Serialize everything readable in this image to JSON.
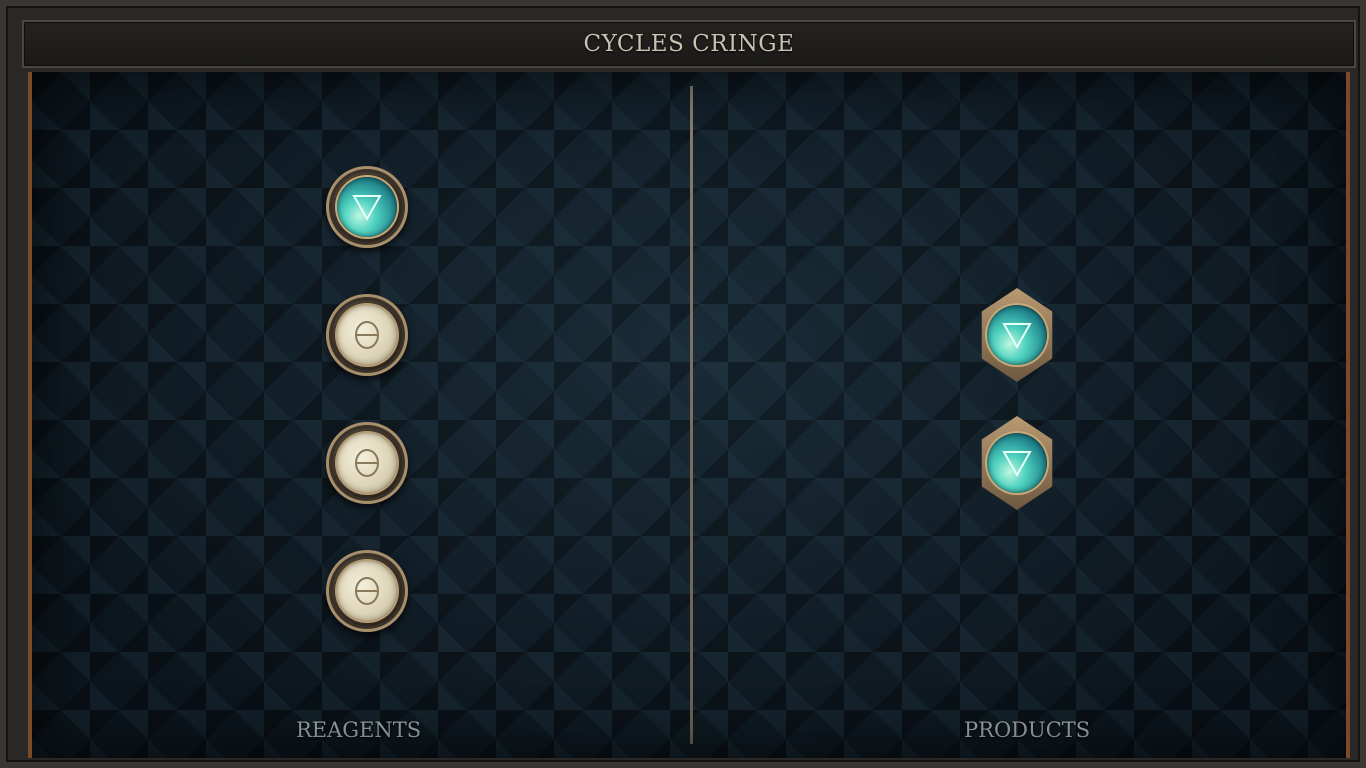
{
  "window": {
    "title": "CYCLES CRINGE"
  },
  "reagents": {
    "label": "REAGENTS",
    "atoms": [
      {
        "element": "water",
        "symbol": "water-triangle-icon"
      },
      {
        "element": "salt",
        "symbol": "salt-theta-icon"
      },
      {
        "element": "salt",
        "symbol": "salt-theta-icon"
      },
      {
        "element": "salt",
        "symbol": "salt-theta-icon"
      }
    ]
  },
  "products": {
    "label": "PRODUCTS",
    "atoms": [
      {
        "element": "water",
        "symbol": "water-triangle-icon"
      },
      {
        "element": "water",
        "symbol": "water-triangle-icon"
      }
    ]
  },
  "colors": {
    "board_background": "#0e1820",
    "frame_accent": "#7a4a2a",
    "water_orb": "#4fd2c0",
    "salt_orb": "#ddd5b8",
    "label_text": "#9aa3a6"
  }
}
